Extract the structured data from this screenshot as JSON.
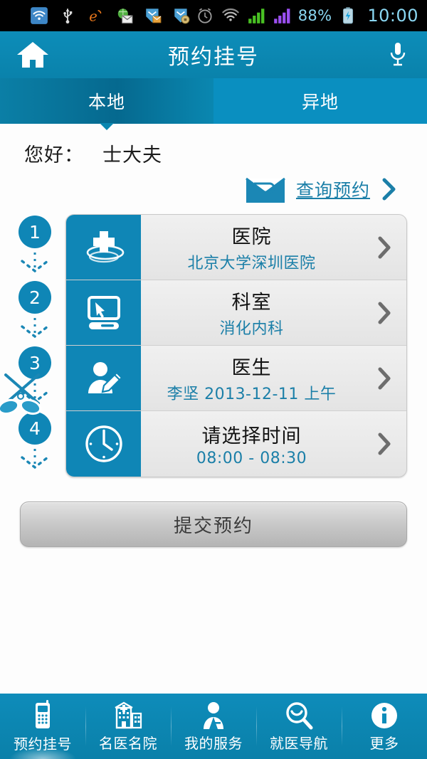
{
  "statusbar": {
    "icons": [
      "wifi-signal-icon",
      "usb-icon",
      "e-browser-icon",
      "email-globe-icon",
      "mail-badge-icon",
      "mail-lock-icon"
    ],
    "right_icons": [
      "alarm-clock-icon",
      "wifi-icon",
      "signal-bars-green-icon",
      "signal-bars-purple-icon",
      "battery-charging-icon"
    ],
    "battery": "88%",
    "time": "10:00"
  },
  "header": {
    "title": "预约挂号",
    "home_icon": "home-icon",
    "mic_icon": "microphone-icon"
  },
  "tabs": [
    {
      "label": "本地",
      "active": true
    },
    {
      "label": "异地",
      "active": false
    }
  ],
  "greeting": {
    "label": "您好：",
    "name": "士大夫"
  },
  "query": {
    "icon": "envelope-icon",
    "label": "查询预约",
    "chevron": "chevron-right-icon"
  },
  "steps": [
    "1",
    "2",
    "3",
    "4"
  ],
  "rows": [
    {
      "step": "1",
      "icon": "hospital-cross-icon",
      "title": "医院",
      "subtitle": "北京大学深圳医院"
    },
    {
      "step": "2",
      "icon": "monitor-cursor-icon",
      "title": "科室",
      "subtitle": "消化内科"
    },
    {
      "step": "3",
      "icon": "person-pencil-icon",
      "title": "医生",
      "subtitle": "李坚 2013-12-11 上午"
    },
    {
      "step": "4",
      "icon": "clock-icon",
      "title": "请选择时间",
      "subtitle": "08:00 - 08:30"
    }
  ],
  "submit": {
    "label": "提交预约"
  },
  "bottomnav": [
    {
      "icon": "mobile-phone-icon",
      "label": "预约挂号",
      "active": true
    },
    {
      "icon": "hospital-building-icon",
      "label": "名医名院",
      "active": false
    },
    {
      "icon": "doctor-person-icon",
      "label": "我的服务",
      "active": false
    },
    {
      "icon": "magnifier-icon",
      "label": "就医导航",
      "active": false
    },
    {
      "icon": "info-circle-icon",
      "label": "更多",
      "active": false
    }
  ],
  "colors": {
    "brand_blue": "#0f86b6",
    "header_blue": "#0d8db9",
    "tab_active": "#05698f",
    "link_blue": "#1b7fa8",
    "card_gray": "#ebebeb"
  }
}
